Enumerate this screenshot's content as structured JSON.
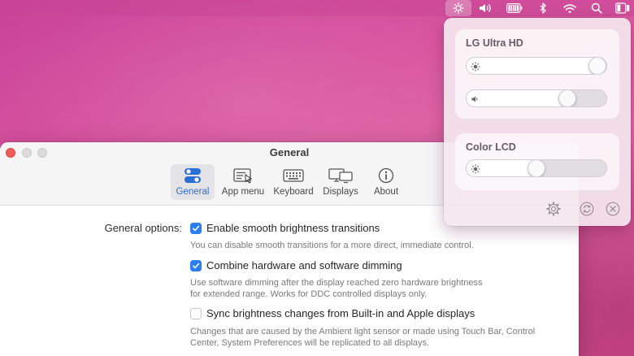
{
  "colors": {
    "accent": "#2c7df2",
    "close_button": "#ee5d57",
    "popover_background": "#f4e6ee"
  },
  "menubar": {
    "icons": [
      "sun-icon",
      "speaker-icon",
      "battery-icon",
      "bluetooth-icon",
      "wifi-icon",
      "search-icon",
      "control-center-icon"
    ]
  },
  "window": {
    "title": "General",
    "tabs": [
      {
        "label": "General",
        "icon": "toggles-icon",
        "active": true
      },
      {
        "label": "App menu",
        "icon": "app-menu-icon",
        "active": false
      },
      {
        "label": "Keyboard",
        "icon": "keyboard-icon",
        "active": false
      },
      {
        "label": "Displays",
        "icon": "displays-icon",
        "active": false
      },
      {
        "label": "About",
        "icon": "info-icon",
        "active": false
      }
    ],
    "section_label": "General options:",
    "options": [
      {
        "label": "Enable smooth brightness transitions",
        "checked": true,
        "description": [
          "You can disable smooth transitions for a more direct, immediate control."
        ]
      },
      {
        "label": "Combine hardware and software dimming",
        "checked": true,
        "description": [
          "Use software dimming after the display reached zero hardware brightness",
          "for extended range. Works for DDC controlled displays only."
        ]
      },
      {
        "label": "Sync brightness changes from Built-in and Apple displays",
        "checked": false,
        "description": [
          "Changes that are caused by the Ambient light sensor or made using Touch Bar, Control",
          "Center, System Preferences will be replicated to all displays."
        ]
      }
    ]
  },
  "popover": {
    "displays": [
      {
        "name": "LG Ultra HD",
        "sliders": [
          {
            "icon": "sun-icon",
            "value": 1.0
          },
          {
            "icon": "speaker-icon",
            "value": 0.75
          }
        ]
      },
      {
        "name": "Color LCD",
        "sliders": [
          {
            "icon": "sun-icon",
            "value": 0.5
          }
        ]
      }
    ],
    "footer_icons": [
      "gear-icon",
      "reset-icon",
      "quit-icon"
    ]
  }
}
